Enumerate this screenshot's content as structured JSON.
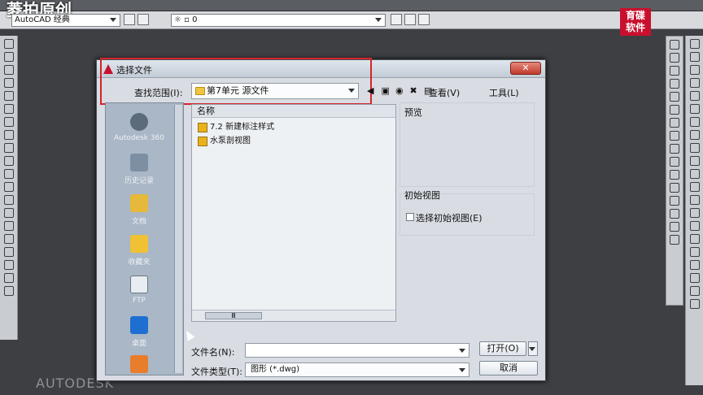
{
  "app": {
    "logo_text": "菱拍原创",
    "workspace": "AutoCAD 经典",
    "layer_value": "0",
    "watermark_line1": "育碟",
    "watermark_line2": "软件",
    "brand": "AUTODESK"
  },
  "dialog": {
    "title": "选择文件",
    "close_label": "✕",
    "look_in_label": "查找范围(I):",
    "look_in_value": "第7单元 源文件",
    "view_label": "查看(V)",
    "tools_label": "工具(L)",
    "places": [
      {
        "label": "Autodesk 360"
      },
      {
        "label": "历史记录"
      },
      {
        "label": "文档"
      },
      {
        "label": "收藏夹"
      },
      {
        "label": "FTP"
      },
      {
        "label": "桌面"
      }
    ],
    "column_header": "名称",
    "files": [
      {
        "name": "7.2 新建标注样式"
      },
      {
        "name": "水泵剖视图"
      }
    ],
    "scroll_thumb_text": "Ⅲ",
    "preview_label": "预览",
    "initial_view_label": "初始视图",
    "select_initial_view_label": "选择初始视图(E)",
    "file_name_label": "文件名(N):",
    "file_name_value": "",
    "file_type_label": "文件类型(T):",
    "file_type_value": "图形 (*.dwg)",
    "open_button": "打开(O)",
    "cancel_button": "取消"
  },
  "colors": {
    "highlight_box": "#d5242a",
    "watermark_bg": "#c8102e"
  }
}
